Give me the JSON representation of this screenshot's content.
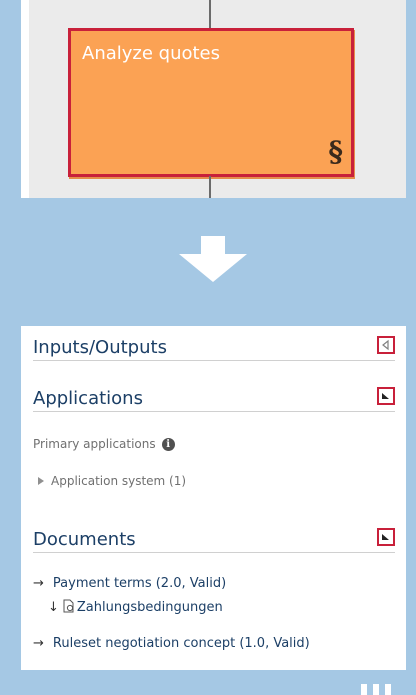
{
  "model": {
    "function_label": "Analyze quotes",
    "rule_symbol": "§",
    "colors": {
      "box_fill": "#fba254",
      "box_border": "#c8203a"
    }
  },
  "details": {
    "sections": {
      "inputs_outputs": {
        "title": "Inputs/Outputs",
        "state": "collapsed"
      },
      "applications": {
        "title": "Applications",
        "state": "expanded"
      },
      "documents": {
        "title": "Documents",
        "state": "expanded"
      }
    },
    "applications": {
      "primary_label": "Primary applications",
      "info_icon": "info-icon",
      "tree_item": "Application system (1)"
    },
    "documents": {
      "items": [
        {
          "arrow": "→",
          "label": "Payment terms (2.0, Valid)"
        },
        {
          "arrow": "↓",
          "label": "Zahlungsbedingungen"
        },
        {
          "arrow": "→",
          "label": "Ruleset negotiation concept (1.0, Valid)"
        }
      ]
    }
  }
}
